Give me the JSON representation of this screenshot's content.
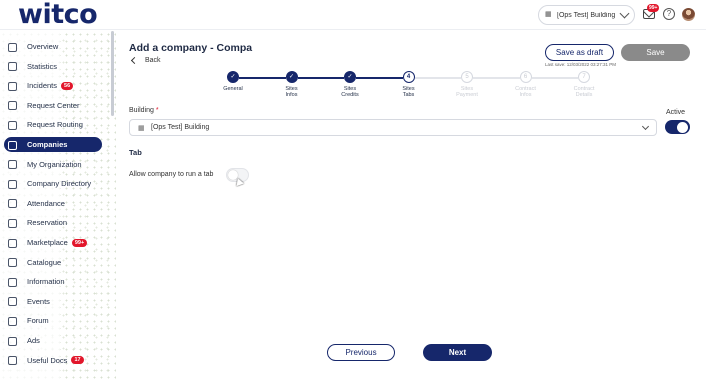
{
  "header": {
    "logo": "witco",
    "building_selector": "[Ops Test] Building",
    "notifications_badge": "99+"
  },
  "sidebar": {
    "items": [
      {
        "label": "Overview",
        "icon": "eye-icon"
      },
      {
        "label": "Statistics",
        "icon": "chart-icon"
      },
      {
        "label": "Incidents",
        "icon": "warning-icon",
        "badge": "56"
      },
      {
        "label": "Request Center",
        "icon": "inbox-icon"
      },
      {
        "label": "Request Routing",
        "icon": "routing-icon"
      },
      {
        "label": "Companies",
        "icon": "building-icon",
        "active": true
      },
      {
        "label": "My Organization",
        "icon": "organization-icon"
      },
      {
        "label": "Company Directory",
        "icon": "directory-icon"
      },
      {
        "label": "Attendance",
        "icon": "check-circle-icon"
      },
      {
        "label": "Reservation",
        "icon": "calendar-icon"
      },
      {
        "label": "Marketplace",
        "icon": "store-icon",
        "badge": "99+"
      },
      {
        "label": "Catalogue",
        "icon": "book-icon"
      },
      {
        "label": "Information",
        "icon": "info-icon"
      },
      {
        "label": "Events",
        "icon": "event-icon"
      },
      {
        "label": "Forum",
        "icon": "chat-icon"
      },
      {
        "label": "Ads",
        "icon": "tag-icon"
      },
      {
        "label": "Useful Docs",
        "icon": "document-icon",
        "badge": "17"
      }
    ]
  },
  "main": {
    "title": "Add a company - Compa",
    "back": "Back",
    "save_draft": "Save as draft",
    "save": "Save",
    "last_save": "Last save: 12/03/2022 03:27:31 PM",
    "steps": [
      {
        "label": "General",
        "state": "done",
        "marker": "✓"
      },
      {
        "label": "Sites Infos",
        "state": "done",
        "marker": "✓"
      },
      {
        "label": "Sites Credits",
        "state": "done",
        "marker": "✓"
      },
      {
        "label": "Sites Tabs",
        "state": "current",
        "marker": "4"
      },
      {
        "label": "Sites Payment",
        "state": "todo",
        "marker": "5"
      },
      {
        "label": "Contract Infos",
        "state": "todo",
        "marker": "6"
      },
      {
        "label": "Contract Details",
        "state": "todo",
        "marker": "7"
      }
    ],
    "building_label": "Building",
    "required_mark": "*",
    "building_value": "[Ops Test] Building",
    "active_label": "Active",
    "active_on": true,
    "tab_section": "Tab",
    "allow_tab_label": "Allow company to run a tab",
    "allow_tab_on": false,
    "previous": "Previous",
    "next": "Next"
  },
  "colors": {
    "brand": "#16276b",
    "badge": "#e2162b",
    "disabled_button": "#8a8a8a"
  }
}
